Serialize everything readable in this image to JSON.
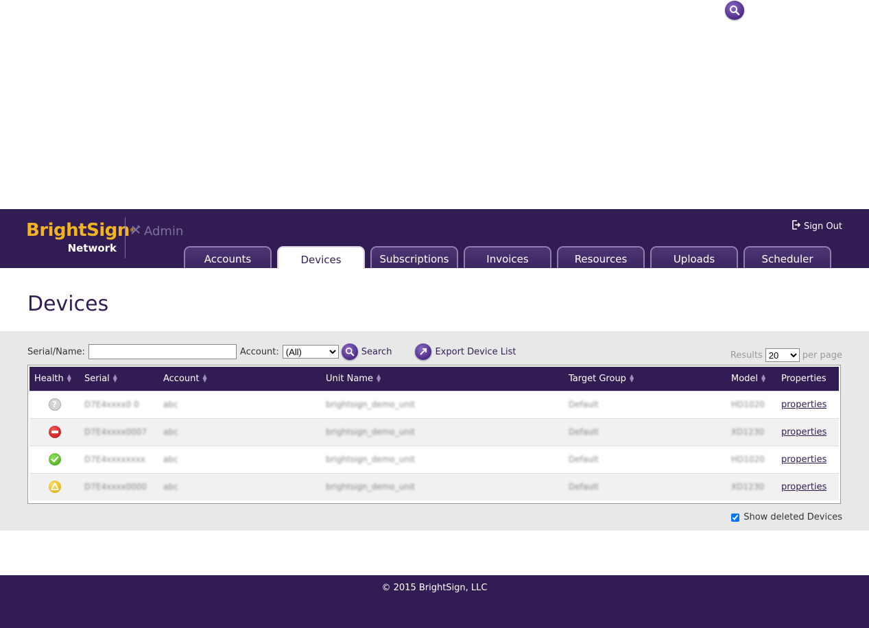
{
  "header": {
    "logo_brand": "BrightSign",
    "logo_sub": "Network",
    "admin_label": "Admin",
    "sign_out": "Sign Out",
    "tabs": [
      {
        "label": "Accounts"
      },
      {
        "label": "Devices"
      },
      {
        "label": "Subscriptions"
      },
      {
        "label": "Invoices"
      },
      {
        "label": "Resources"
      },
      {
        "label": "Uploads"
      },
      {
        "label": "Scheduler"
      }
    ],
    "active_tab": "Devices"
  },
  "page": {
    "title": "Devices"
  },
  "filters": {
    "serial_label": "Serial/Name:",
    "serial_value": "",
    "account_label": "Account:",
    "account_value": "(All)",
    "search_label": "Search",
    "export_label": "Export Device List",
    "results_label": "Results",
    "results_value": "20",
    "per_page_label": "per page"
  },
  "table": {
    "columns": [
      "Health",
      "Serial",
      "Account",
      "Unit Name",
      "Target Group",
      "Model",
      "Properties"
    ],
    "rows": [
      {
        "health": "unknown",
        "serial": "D7E4xxxx0 0",
        "account": "abc",
        "unit_name": "brightsign_demo_unit",
        "target_group": "Default",
        "model": "HD1020",
        "properties": "properties"
      },
      {
        "health": "error",
        "serial": "D7E4xxxx0007",
        "account": "abc",
        "unit_name": "brightsign_demo_unit",
        "target_group": "Default",
        "model": "XD1230",
        "properties": "properties"
      },
      {
        "health": "ok",
        "serial": "D7E4xxxxxxxx",
        "account": "abc",
        "unit_name": "brightsign_demo_unit",
        "target_group": "Default",
        "model": "HD1020",
        "properties": "properties"
      },
      {
        "health": "warning",
        "serial": "D7E4xxxx0000",
        "account": "abc",
        "unit_name": "brightsign_demo_unit",
        "target_group": "Default",
        "model": "XD1230",
        "properties": "properties"
      }
    ]
  },
  "show_deleted": {
    "label": "Show deleted Devices",
    "checked": true
  },
  "footer": {
    "copyright": "© 2015 BrightSign, LLC"
  },
  "colors": {
    "brand_purple": "#321c54",
    "brand_gold": "#f0b323",
    "panel_gray": "#e8e8e8"
  }
}
